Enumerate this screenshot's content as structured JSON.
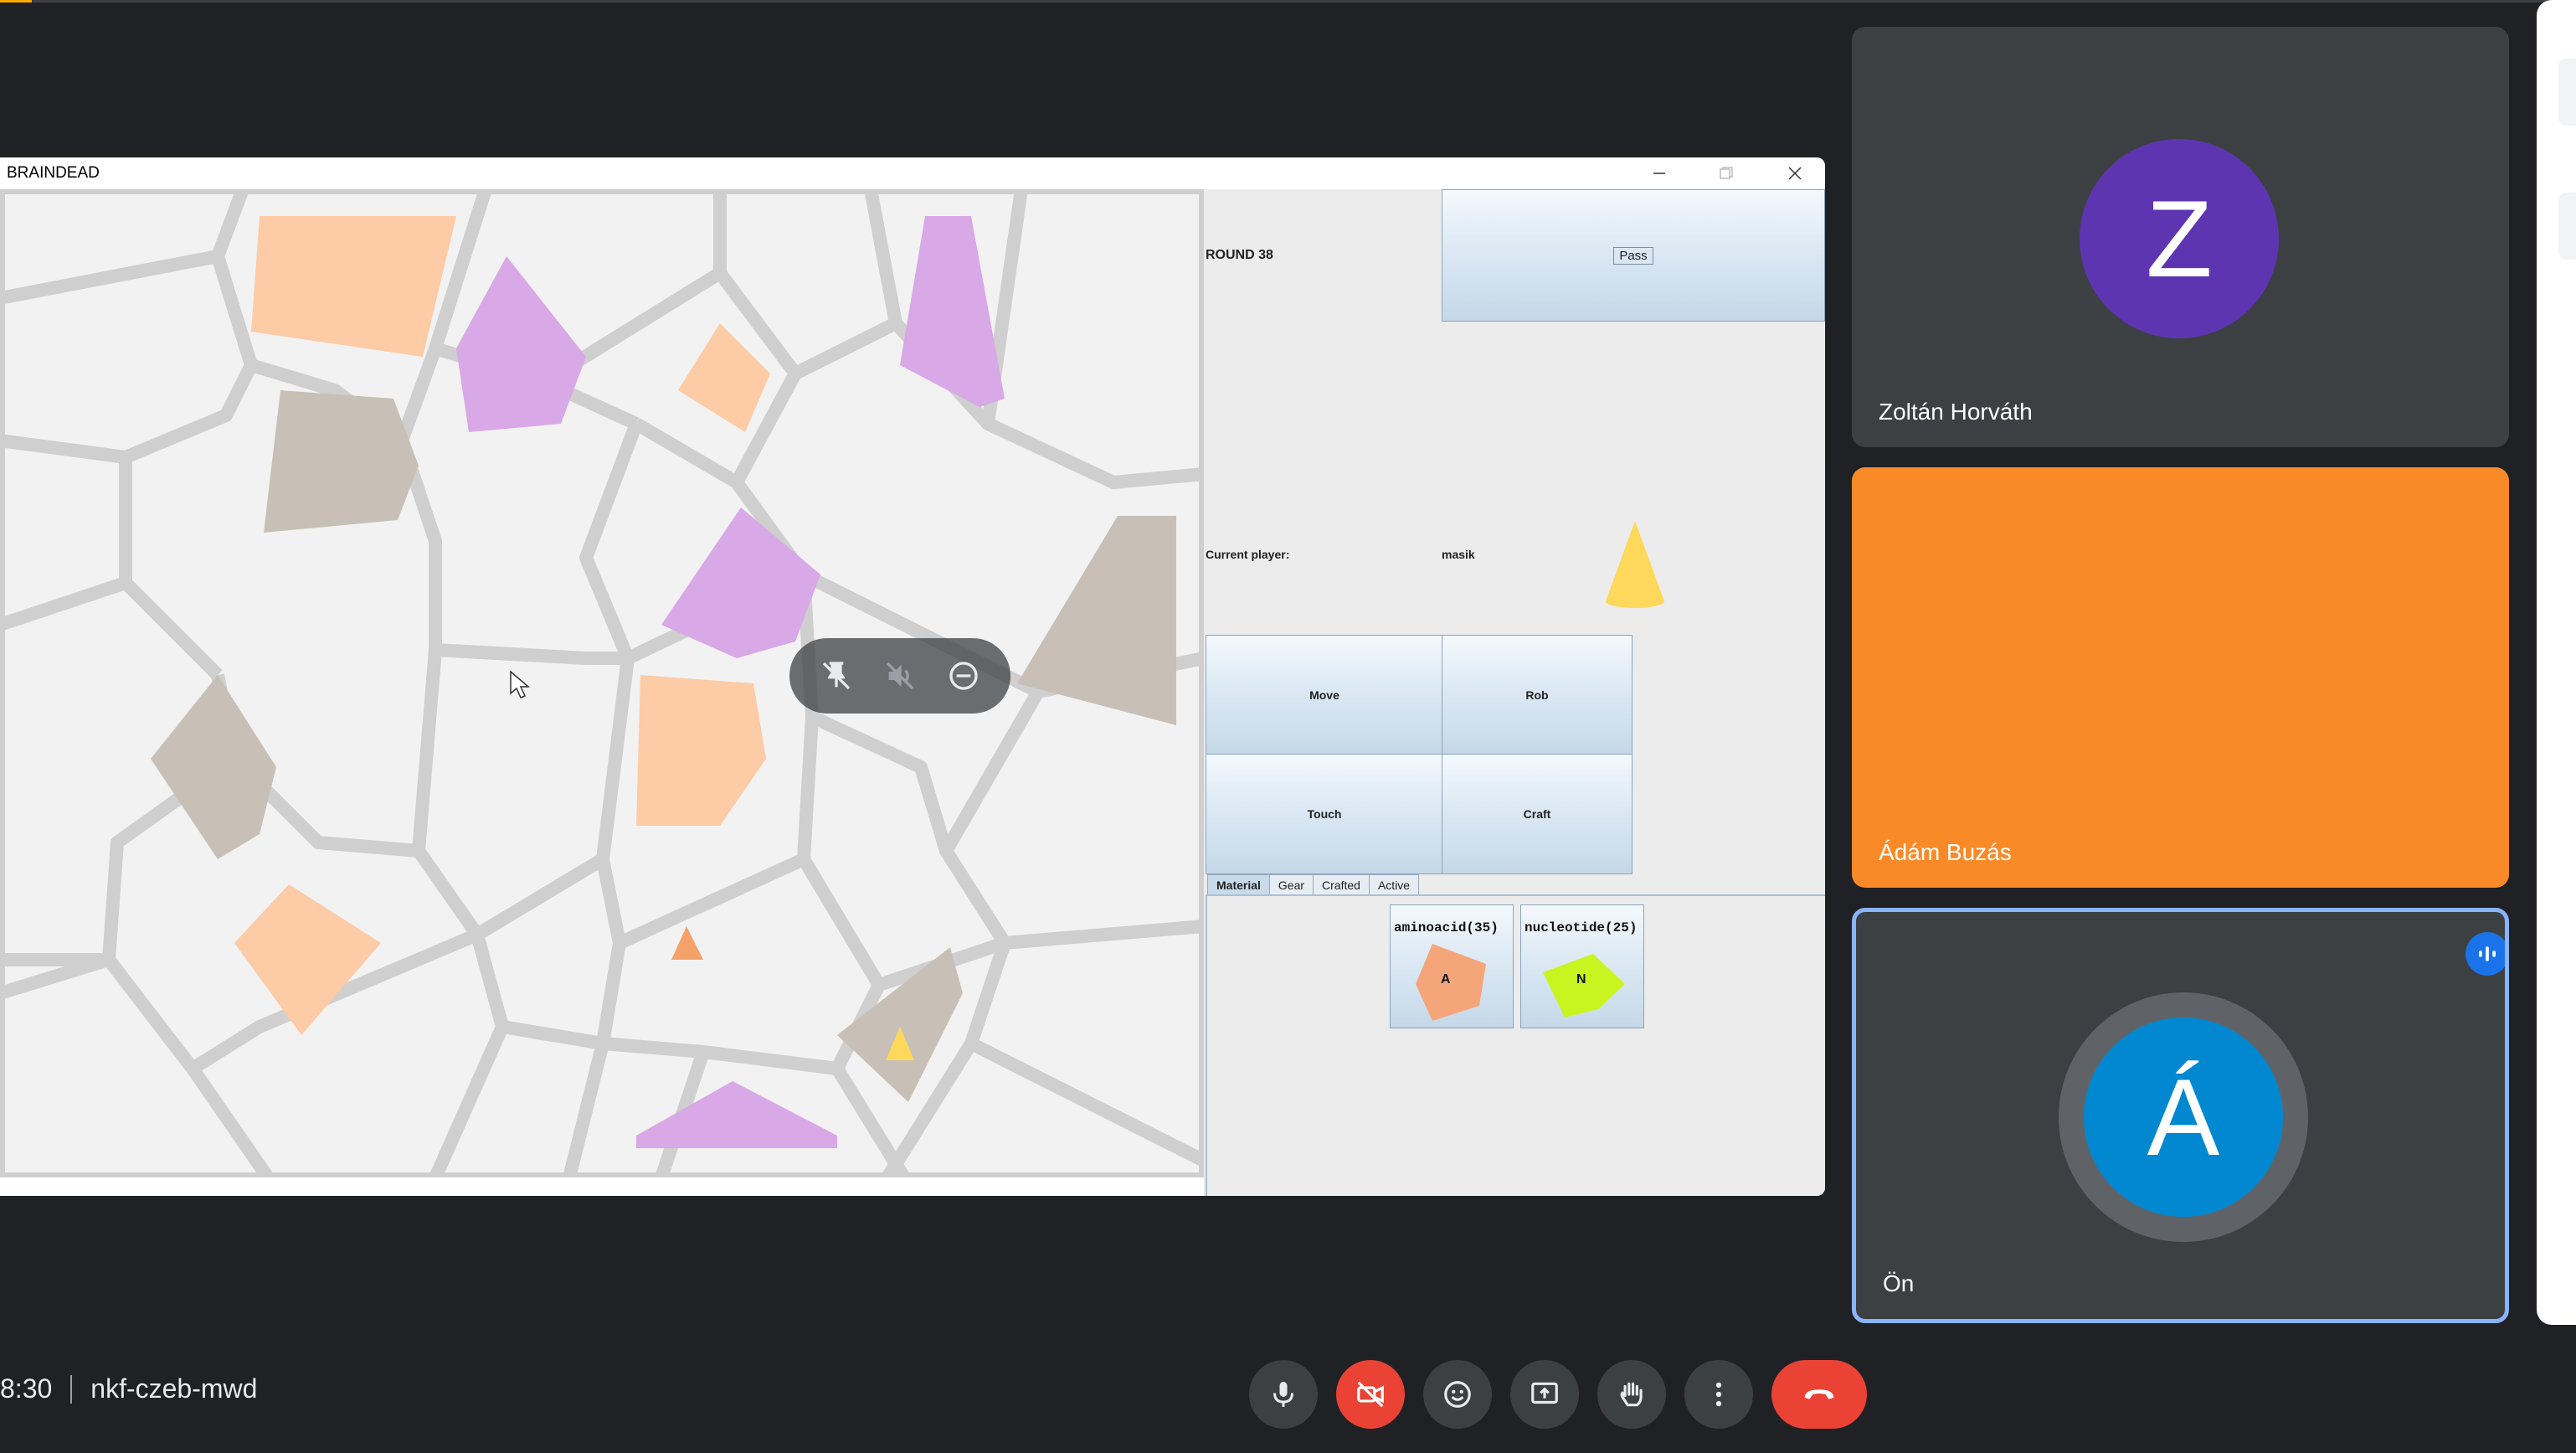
{
  "app": {
    "window_title": "BRAINDEAD"
  },
  "game": {
    "round": "ROUND 38",
    "pass_label": "Pass",
    "current_player_label": "Current player:",
    "current_player": "masik",
    "actions": [
      "Move",
      "Rob",
      "Touch",
      "Craft"
    ],
    "tabs": [
      "Material",
      "Gear",
      "Crafted",
      "Active"
    ],
    "active_tab": "Material",
    "materials": [
      {
        "label": "aminoacid(35)",
        "letter": "A",
        "color": "#f4a67a"
      },
      {
        "label": "nucleotide(25)",
        "letter": "N",
        "color": "#c8f51f"
      }
    ],
    "cell_colors": {
      "peach": "#fdcba6",
      "lilac": "#d9a8e6",
      "taupe": "#c8c0b6",
      "empty": "#ffffff",
      "border": "#d0d0d0"
    },
    "player_marker_color": "#fdd85a",
    "other_marker_color": "#f4a26a"
  },
  "participants": [
    {
      "name": "Zoltán Horváth",
      "initial": "Z",
      "avatar_color": "#5e35b1"
    },
    {
      "name": "Ádám Buzás",
      "tile_color": "#fa8a28"
    },
    {
      "name": "Ön",
      "initial": "Á",
      "avatar_color": "#0288d1",
      "speaking": true
    }
  ],
  "meeting": {
    "time": "8:30",
    "code": "nkf-czeb-mwd"
  },
  "controls": [
    "microphone-icon",
    "camera-off-icon",
    "emoji-icon",
    "present-icon",
    "raise-hand-icon",
    "more-options-icon",
    "end-call-icon"
  ]
}
